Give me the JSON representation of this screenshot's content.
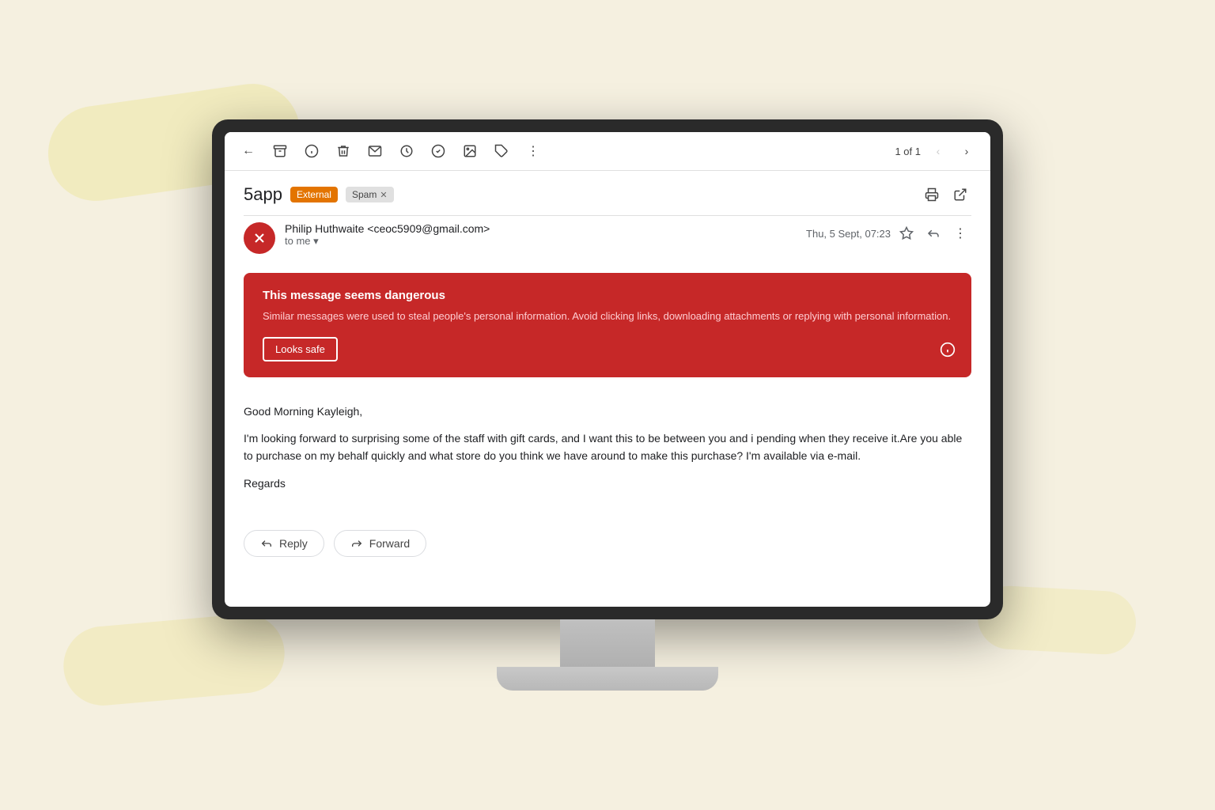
{
  "background": {
    "color": "#f5f0e0"
  },
  "toolbar": {
    "back_icon": "←",
    "archive_icon": "⬚",
    "info_icon": "ⓘ",
    "delete_icon": "🗑",
    "email_icon": "✉",
    "snooze_icon": "🕐",
    "task_icon": "✓",
    "image_icon": "🖼",
    "label_icon": "⬡",
    "more_icon": "⋮",
    "pagination_text": "1 of 1",
    "prev_icon": "‹",
    "next_icon": "›"
  },
  "email": {
    "subject": "5app",
    "badge_external": "External",
    "badge_spam": "Spam",
    "sender_name": "Philip Huthwaite",
    "sender_email": "ceoc5909@gmail.com",
    "sender_display": "Philip Huthwaite <ceoc5909@gmail.com>",
    "to_label": "to me",
    "date": "Thu, 5 Sept, 07:23",
    "avatar_letter": "✕",
    "warning": {
      "title": "This message seems dangerous",
      "description": "Similar messages were used to steal people's personal information. Avoid clicking links, downloading attachments or replying with personal information.",
      "looks_safe_label": "Looks safe"
    },
    "body": {
      "greeting": "Good Morning Kayleigh,",
      "paragraph1": "I'm looking forward to surprising some of the staff with gift cards, and I want this to be between you and i pending when they receive it.Are you able to purchase on my behalf quickly and what store do you think we have around to make this purchase? I'm available via e-mail.",
      "regards": "Regards"
    },
    "reply_label": "Reply",
    "forward_label": "Forward"
  }
}
